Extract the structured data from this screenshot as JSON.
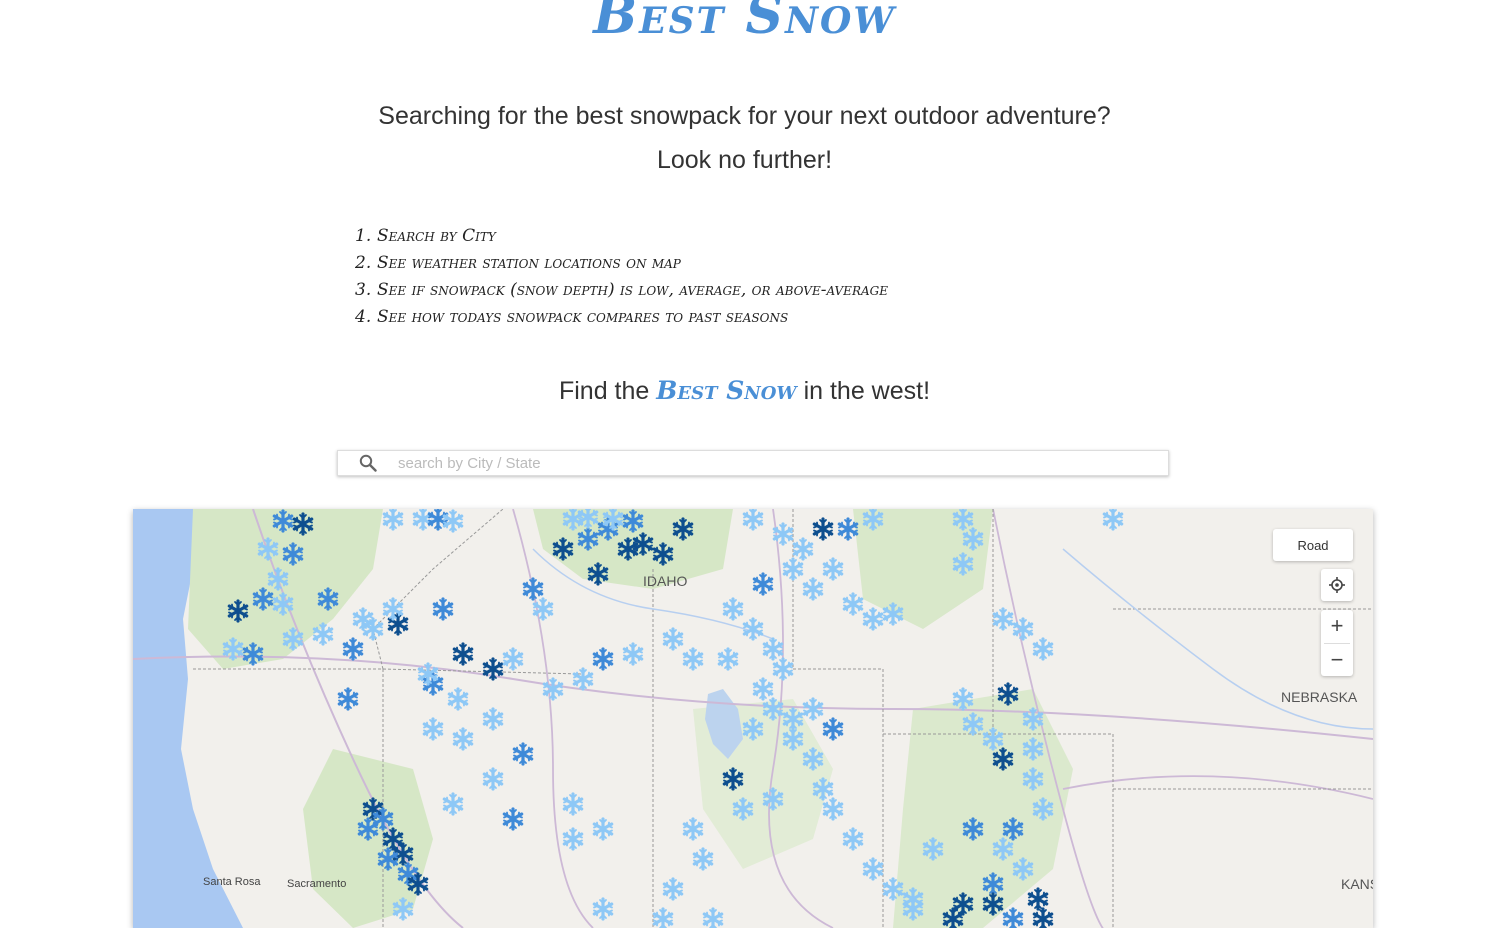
{
  "brand": {
    "title": "Best Snow"
  },
  "intro": {
    "line1": "Searching for the best snowpack for your next outdoor adventure?",
    "line2": "Look no further!"
  },
  "steps": [
    {
      "num": "1.",
      "text": "Search by City"
    },
    {
      "num": "2.",
      "text": "See weather station locations on map"
    },
    {
      "num": "3.",
      "text": "See if snowpack (snow depth) is low, average, or above-average"
    },
    {
      "num": "4.",
      "text": "See how todays snowpack compares to past seasons"
    }
  ],
  "find": {
    "prefix": "Find the",
    "highlight": "Best Snow",
    "suffix": "in the west!"
  },
  "search": {
    "placeholder": "search by City / State",
    "value": "",
    "icon": "search-icon"
  },
  "map": {
    "style_label": "Road",
    "zoom_in": "+",
    "zoom_out": "−",
    "locate_icon": "locate-icon",
    "labels": {
      "idaho": "IDAHO",
      "nebraska": "NEBRASKA",
      "kansas": "KANS",
      "santa_rosa": "Santa Rosa",
      "sacramento": "Sacramento"
    },
    "colors": {
      "low": "#8ec8f6",
      "average": "#3f8ad8",
      "high": "#0e4f8f",
      "water": "#a9c8f2",
      "land": "#f2f0ec",
      "forest": "#cfe3bf"
    }
  }
}
